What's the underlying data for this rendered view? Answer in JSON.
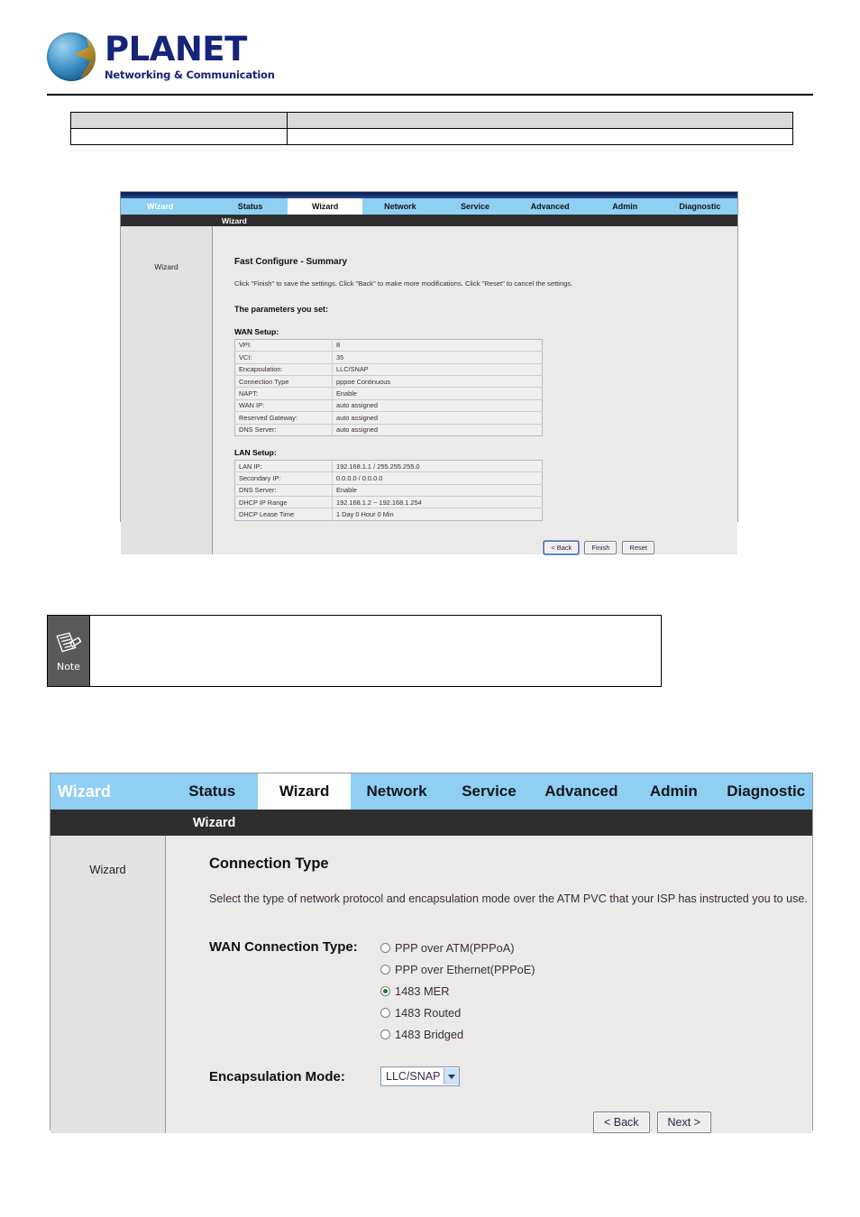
{
  "brand": {
    "name": "PLANET",
    "tagline": "Networking & Communication",
    "logo_icon": "planet-globe-logo"
  },
  "header_table": {
    "rows": [
      {
        "shaded": true,
        "cells": [
          "",
          ""
        ]
      },
      {
        "shaded": false,
        "cells": [
          "",
          ""
        ]
      }
    ]
  },
  "screenshot_summary": {
    "nav": {
      "brand_label": "Wizard",
      "tabs": [
        {
          "label": "Status",
          "active": false
        },
        {
          "label": "Wizard",
          "active": true
        },
        {
          "label": "Network",
          "active": false
        },
        {
          "label": "Service",
          "active": false
        },
        {
          "label": "Advanced",
          "active": false
        },
        {
          "label": "Admin",
          "active": false
        },
        {
          "label": "Diagnostic",
          "active": false
        }
      ],
      "subbar_label": "Wizard"
    },
    "sidebar_label": "Wizard",
    "title": "Fast Configure - Summary",
    "description": "Click \"Finish\" to save the settings. Click \"Back\" to make more modifications. Click \"Reset\" to cancel the settings.",
    "subheading": "The parameters you set:",
    "wan_heading": "WAN Setup:",
    "wan_rows": [
      {
        "key": "VPI:",
        "value": "8"
      },
      {
        "key": "VCI:",
        "value": "35"
      },
      {
        "key": "Encapsulation:",
        "value": "LLC/SNAP"
      },
      {
        "key": "Connection Type",
        "value": "pppoe Continuous"
      },
      {
        "key": "NAPT:",
        "value": "Enable"
      },
      {
        "key": "WAN IP:",
        "value": "auto assigned"
      },
      {
        "key": "Reserved Gateway:",
        "value": "auto assigned"
      },
      {
        "key": "DNS Server:",
        "value": "auto assigned"
      }
    ],
    "lan_heading": "LAN Setup:",
    "lan_rows": [
      {
        "key": "LAN IP:",
        "value": "192.168.1.1 / 255.255.255.0"
      },
      {
        "key": "Secondary IP:",
        "value": "0.0.0.0 / 0.0.0.0"
      },
      {
        "key": "DNS Server:",
        "value": "Enable"
      },
      {
        "key": "DHCP IP Range",
        "value": "192.168.1.2 ~ 192.168.1.254"
      },
      {
        "key": "DHCP Lease Time",
        "value": "1 Day 0 Hour 0 Min"
      }
    ],
    "buttons": [
      {
        "label": "< Back",
        "primary": true
      },
      {
        "label": "Finish",
        "primary": false
      },
      {
        "label": "Reset",
        "primary": false
      }
    ]
  },
  "note": {
    "icon_label": "Note",
    "icon_name": "note-pencil-icon",
    "text": ""
  },
  "screenshot_connection_type": {
    "nav": {
      "brand_label": "Wizard",
      "tabs": [
        {
          "label": "Status",
          "active": false
        },
        {
          "label": "Wizard",
          "active": true
        },
        {
          "label": "Network",
          "active": false
        },
        {
          "label": "Service",
          "active": false
        },
        {
          "label": "Advanced",
          "active": false
        },
        {
          "label": "Admin",
          "active": false
        },
        {
          "label": "Diagnostic",
          "active": false
        }
      ],
      "subbar_label": "Wizard"
    },
    "sidebar_label": "Wizard",
    "title": "Connection Type",
    "description": "Select the type of network protocol and encapsulation mode over the ATM PVC that your ISP has instructed you to use.",
    "wan_type_label": "WAN Connection Type:",
    "wan_type_options": [
      {
        "label": "PPP over ATM(PPPoA)",
        "checked": false
      },
      {
        "label": "PPP over Ethernet(PPPoE)",
        "checked": false
      },
      {
        "label": "1483 MER",
        "checked": true
      },
      {
        "label": "1483 Routed",
        "checked": false
      },
      {
        "label": "1483 Bridged",
        "checked": false
      }
    ],
    "encapsulation_label": "Encapsulation Mode:",
    "encapsulation_value": "LLC/SNAP",
    "buttons": [
      {
        "label": "< Back",
        "primary": false
      },
      {
        "label": "Next >",
        "primary": false
      }
    ]
  },
  "colors": {
    "nav_blue": "#8ecff2",
    "subbar_dark": "#2e2e2e",
    "panel_gray": "#eceae9",
    "radio_selected": "#1a7a2e",
    "logo_navy": "#16247a"
  }
}
